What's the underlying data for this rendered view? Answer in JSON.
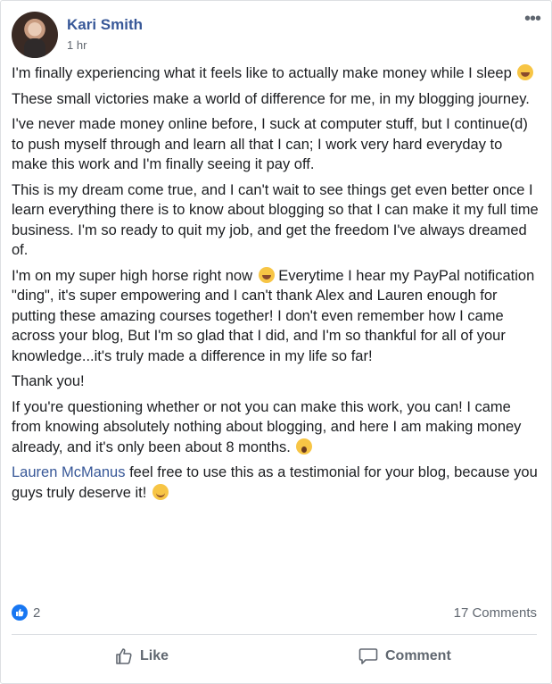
{
  "post": {
    "author": "Kari Smith",
    "time": "1 hr",
    "more_label": "•••",
    "paragraphs": {
      "p1": "I'm finally experiencing what it feels like to actually make money while I sleep",
      "p2": "These small victories make a world of difference for me, in my blogging journey.",
      "p3": "I've never made money online before, I suck at computer stuff, but I continue(d) to push myself through and learn all that I can; I work very hard everyday to make this work and I'm finally seeing it pay off.",
      "p4": "This is my dream come true, and I can't wait to see things get even better once I learn everything there is to know about blogging so that I can make it my full time business. I'm so ready to quit my job, and get the freedom I've always dreamed of.",
      "p5a": "I'm on my super high horse right now",
      "p5b": " Everytime I hear my PayPal notification \"ding\", it's super empowering and I can't thank Alex and Lauren enough for putting these amazing courses together! I don't even remember how I came across your blog, But I'm so glad that I did, and I'm so thankful for all of your knowledge...it's truly made a difference in my life so far!",
      "p6": "Thank you!",
      "p7": "If you're questioning whether or not you can make this work, you can! I came from knowing absolutely nothing about blogging, and here I am making money already, and it's only been about 8 months.",
      "p8_mention": "Lauren McManus",
      "p8_text": " feel free to use this as a testimonial for your blog, because you guys truly deserve it!"
    },
    "reactions": {
      "like_count": "2"
    },
    "comments_count": "17 Comments"
  },
  "actions": {
    "like_label": "Like",
    "comment_label": "Comment"
  },
  "colors": {
    "author": "#385898",
    "like_badge": "#1877f2",
    "muted": "#606770"
  }
}
